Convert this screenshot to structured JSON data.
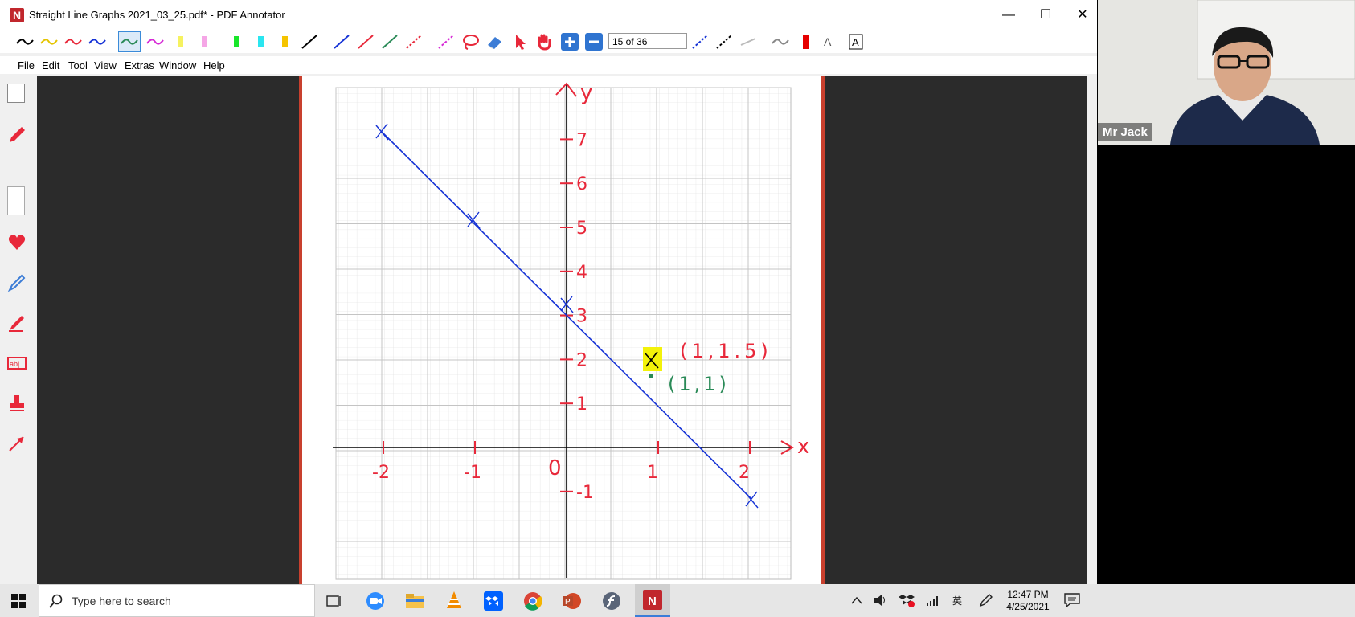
{
  "window": {
    "title": "Straight Line Graphs 2021_03_25.pdf* - PDF Annotator",
    "logo": "N"
  },
  "toolbar": {
    "page_indicator": "15 of 36"
  },
  "menu": [
    "File",
    "Edit",
    "Tool",
    "View",
    "Extras",
    "Window",
    "Help"
  ],
  "graph": {
    "y_axis_label": "y",
    "x_axis_label": "x",
    "origin_label": "0",
    "x_ticks": [
      "-2",
      "-1",
      "1",
      "2"
    ],
    "y_ticks": [
      "7",
      "6",
      "5",
      "4",
      "3",
      "2",
      "1",
      "-1"
    ],
    "point_a_label": "(1,1.5)",
    "point_b_label": "(1,1)",
    "colors": {
      "ink_red": "#e8283a",
      "line_blue": "#1633d6",
      "highlight": "#f3f20a",
      "green": "#2a8a57"
    }
  },
  "video": {
    "participant": "Mr Jack"
  },
  "taskbar": {
    "search_placeholder": "Type here to search",
    "time": "12:47 PM",
    "date": "4/25/2021"
  }
}
